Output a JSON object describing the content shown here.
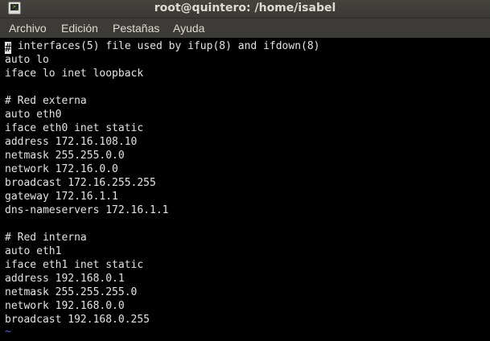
{
  "window": {
    "title": "root@quintero: /home/isabel"
  },
  "menu": {
    "items": [
      "Archivo",
      "Edición",
      "Pestañas",
      "Ayuda"
    ]
  },
  "terminal": {
    "first_char": "#",
    "lines": [
      "# interfaces(5) file used by ifup(8) and ifdown(8)",
      "auto lo",
      "iface lo inet loopback",
      "",
      "# Red externa",
      "auto eth0",
      "iface eth0 inet static",
      "address 172.16.108.10",
      "netmask 255.255.0.0",
      "network 172.16.0.0",
      "broadcast 172.16.255.255",
      "gateway 172.16.1.1",
      "dns-nameservers 172.16.1.1",
      "",
      "# Red interna",
      "auto eth1",
      "iface eth1 inet static",
      "address 192.168.0.1",
      "netmask 255.255.255.0",
      "network 192.168.0.0",
      "broadcast 192.168.0.255"
    ],
    "first_line_rest": " interfaces(5) file used by ifup(8) and ifdown(8)",
    "tilde": "~"
  },
  "colors": {
    "titlebar": "#45443f",
    "menubar": "#3c3b37",
    "terminal_bg": "#000000",
    "terminal_fg": "#e3e3e3",
    "tilde": "#5a5aff"
  }
}
